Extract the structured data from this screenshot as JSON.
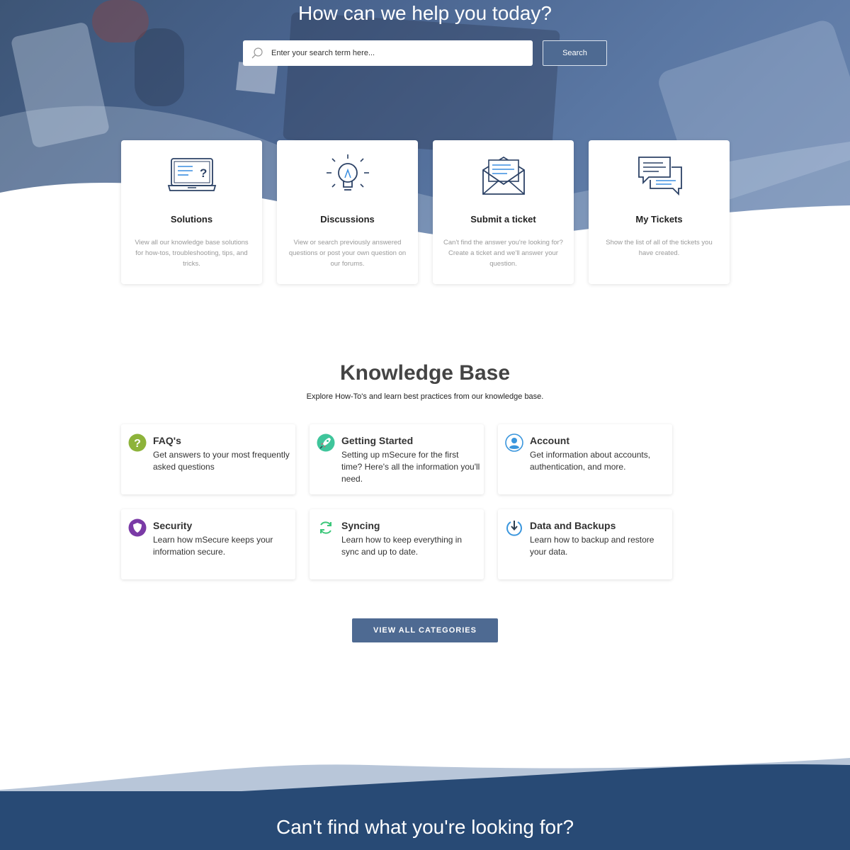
{
  "hero": {
    "title": "How can we help you today?",
    "search_placeholder": "Enter your search term here...",
    "search_button": "Search"
  },
  "cards": [
    {
      "title": "Solutions",
      "description": "View all our knowledge base solutions for how-tos, troubleshooting, tips, and tricks.",
      "icon": "laptop-question-icon"
    },
    {
      "title": "Discussions",
      "description": "View or search previously answered questions or post your own question on our forums.",
      "icon": "lightbulb-icon"
    },
    {
      "title": "Submit a ticket",
      "description": "Can't find the answer you're looking for? Create a ticket and we'll answer your question.",
      "icon": "envelope-icon"
    },
    {
      "title": "My Tickets",
      "description": "Show the list of all of the tickets you have created.",
      "icon": "chat-bubbles-icon"
    }
  ],
  "knowledge_base": {
    "title": "Knowledge Base",
    "subtitle": "Explore How-To's and learn best practices from our knowledge base.",
    "categories": [
      {
        "title": "FAQ's",
        "description": "Get answers to your most frequently asked questions",
        "icon": "question-circle-icon",
        "color": "#8db33a"
      },
      {
        "title": "Getting Started",
        "description": "Setting up mSecure for the first time? Here's all the information you'll need.",
        "icon": "rocket-icon",
        "color": "#3fc59b"
      },
      {
        "title": "Account",
        "description": "Get information about accounts, authentication, and more.",
        "icon": "user-circle-icon",
        "color": "#3a96dd"
      },
      {
        "title": "Security",
        "description": "Learn how mSecure keeps your information secure.",
        "icon": "shield-icon",
        "color": "#7a3aa6"
      },
      {
        "title": "Syncing",
        "description": "Learn how to keep everything in sync and up to date.",
        "icon": "sync-icon",
        "color": "#3cc77a"
      },
      {
        "title": "Data and Backups",
        "description": "Learn how to backup and restore your data.",
        "icon": "download-icon",
        "color": "#3a96dd"
      }
    ],
    "view_all": "VIEW ALL CATEGORIES"
  },
  "footer": {
    "title": "Can't find what you're looking for?"
  },
  "colors": {
    "primary": "#4e6a92",
    "footer": "#284a75",
    "icon_line": "#2c4266",
    "icon_accent": "#3a8ee0"
  }
}
